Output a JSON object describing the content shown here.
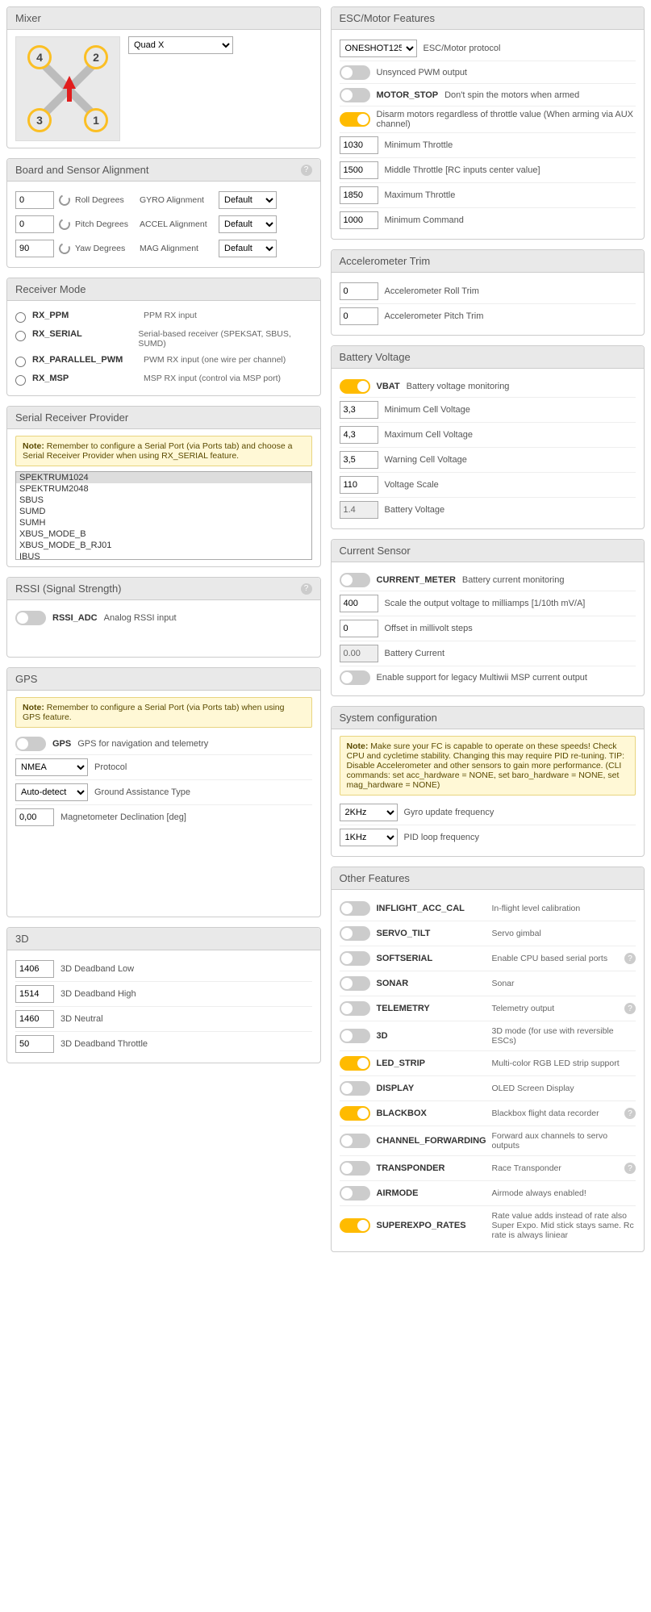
{
  "mixer": {
    "title": "Mixer",
    "type": "Quad X"
  },
  "escMotor": {
    "title": "ESC/Motor Features",
    "protocolLabel": "ESC/Motor protocol",
    "protocol": "ONESHOT125",
    "unsyncedPwm": {
      "on": false,
      "label": "Unsynced PWM output"
    },
    "motorStop": {
      "on": false,
      "name": "MOTOR_STOP",
      "label": "Don't spin the motors when armed"
    },
    "disarm": {
      "on": true,
      "label": "Disarm motors regardless of throttle value (When arming via AUX channel)"
    },
    "minThrottle": {
      "value": "1030",
      "label": "Minimum Throttle"
    },
    "midThrottle": {
      "value": "1500",
      "label": "Middle Throttle [RC inputs center value]"
    },
    "maxThrottle": {
      "value": "1850",
      "label": "Maximum Throttle"
    },
    "minCommand": {
      "value": "1000",
      "label": "Minimum Command"
    }
  },
  "alignment": {
    "title": "Board and Sensor Alignment",
    "roll": {
      "value": "0",
      "label": "Roll Degrees"
    },
    "pitch": {
      "value": "0",
      "label": "Pitch Degrees"
    },
    "yaw": {
      "value": "90",
      "label": "Yaw Degrees"
    },
    "gyro": {
      "label": "GYRO Alignment",
      "value": "Default"
    },
    "accel": {
      "label": "ACCEL Alignment",
      "value": "Default"
    },
    "mag": {
      "label": "MAG Alignment",
      "value": "Default"
    }
  },
  "accTrim": {
    "title": "Accelerometer Trim",
    "roll": {
      "value": "0",
      "label": "Accelerometer Roll Trim"
    },
    "pitch": {
      "value": "0",
      "label": "Accelerometer Pitch Trim"
    }
  },
  "receiverMode": {
    "title": "Receiver Mode",
    "options": [
      {
        "name": "RX_PPM",
        "desc": "PPM RX input"
      },
      {
        "name": "RX_SERIAL",
        "desc": "Serial-based receiver (SPEKSAT, SBUS, SUMD)"
      },
      {
        "name": "RX_PARALLEL_PWM",
        "desc": "PWM RX input (one wire per channel)"
      },
      {
        "name": "RX_MSP",
        "desc": "MSP RX input (control via MSP port)"
      }
    ]
  },
  "battery": {
    "title": "Battery Voltage",
    "vbat": {
      "on": true,
      "name": "VBAT",
      "label": "Battery voltage monitoring"
    },
    "minCell": {
      "value": "3,3",
      "label": "Minimum Cell Voltage"
    },
    "maxCell": {
      "value": "4,3",
      "label": "Maximum Cell Voltage"
    },
    "warnCell": {
      "value": "3,5",
      "label": "Warning Cell Voltage"
    },
    "scale": {
      "value": "110",
      "label": "Voltage Scale"
    },
    "voltage": {
      "value": "1.4",
      "label": "Battery Voltage"
    }
  },
  "serialProvider": {
    "title": "Serial Receiver Provider",
    "note": "Remember to configure a Serial Port (via Ports tab) and choose a Serial Receiver Provider when using RX_SERIAL feature.",
    "options": [
      "SPEKTRUM1024",
      "SPEKTRUM2048",
      "SBUS",
      "SUMD",
      "SUMH",
      "XBUS_MODE_B",
      "XBUS_MODE_B_RJ01",
      "IBUS"
    ],
    "selected": 0
  },
  "currentSensor": {
    "title": "Current Sensor",
    "meter": {
      "on": false,
      "name": "CURRENT_METER",
      "label": "Battery current monitoring"
    },
    "scale": {
      "value": "400",
      "label": "Scale the output voltage to milliamps [1/10th mV/A]"
    },
    "offset": {
      "value": "0",
      "label": "Offset in millivolt steps"
    },
    "current": {
      "value": "0.00",
      "label": "Battery Current"
    },
    "legacy": {
      "on": false,
      "label": "Enable support for legacy Multiwii MSP current output"
    }
  },
  "rssi": {
    "title": "RSSI (Signal Strength)",
    "adc": {
      "on": false,
      "name": "RSSI_ADC",
      "label": "Analog RSSI input"
    }
  },
  "system": {
    "title": "System configuration",
    "note": "Make sure your FC is capable to operate on these speeds! Check CPU and cycletime stability. Changing this may require PID re-tuning. TIP: Disable Accelerometer and other sensors to gain more performance. (CLI commands: set acc_hardware = NONE, set baro_hardware = NONE, set mag_hardware = NONE)",
    "gyro": {
      "value": "2KHz",
      "label": "Gyro update frequency"
    },
    "pid": {
      "value": "1KHz",
      "label": "PID loop frequency"
    }
  },
  "gps": {
    "title": "GPS",
    "note": "Remember to configure a Serial Port (via Ports tab) when using GPS feature.",
    "enable": {
      "on": false,
      "name": "GPS",
      "label": "GPS for navigation and telemetry"
    },
    "protocol": {
      "value": "NMEA",
      "label": "Protocol"
    },
    "ground": {
      "value": "Auto-detect",
      "label": "Ground Assistance Type"
    },
    "magdec": {
      "value": "0,00",
      "label": "Magnetometer Declination [deg]"
    }
  },
  "otherFeatures": {
    "title": "Other Features",
    "items": [
      {
        "on": false,
        "name": "INFLIGHT_ACC_CAL",
        "desc": "In-flight level calibration",
        "help": false
      },
      {
        "on": false,
        "name": "SERVO_TILT",
        "desc": "Servo gimbal",
        "help": false
      },
      {
        "on": false,
        "name": "SOFTSERIAL",
        "desc": "Enable CPU based serial ports",
        "help": true
      },
      {
        "on": false,
        "name": "SONAR",
        "desc": "Sonar",
        "help": false
      },
      {
        "on": false,
        "name": "TELEMETRY",
        "desc": "Telemetry output",
        "help": true
      },
      {
        "on": false,
        "name": "3D",
        "desc": "3D mode (for use with reversible ESCs)",
        "help": false
      },
      {
        "on": true,
        "name": "LED_STRIP",
        "desc": "Multi-color RGB LED strip support",
        "help": false
      },
      {
        "on": false,
        "name": "DISPLAY",
        "desc": "OLED Screen Display",
        "help": false
      },
      {
        "on": true,
        "name": "BLACKBOX",
        "desc": "Blackbox flight data recorder",
        "help": true
      },
      {
        "on": false,
        "name": "CHANNEL_FORWARDING",
        "desc": "Forward aux channels to servo outputs",
        "help": false
      },
      {
        "on": false,
        "name": "TRANSPONDER",
        "desc": "Race Transponder",
        "help": true
      },
      {
        "on": false,
        "name": "AIRMODE",
        "desc": "Airmode always enabled!",
        "help": false
      },
      {
        "on": true,
        "name": "SUPEREXPO_RATES",
        "desc": "Rate value adds instead of rate also Super Expo. Mid stick stays same. Rc rate is always liniear",
        "help": false
      }
    ]
  },
  "threeD": {
    "title": "3D",
    "low": {
      "value": "1406",
      "label": "3D Deadband Low"
    },
    "high": {
      "value": "1514",
      "label": "3D Deadband High"
    },
    "neutral": {
      "value": "1460",
      "label": "3D Neutral"
    },
    "throttle": {
      "value": "50",
      "label": "3D Deadband Throttle"
    }
  },
  "noteWord": "Note"
}
